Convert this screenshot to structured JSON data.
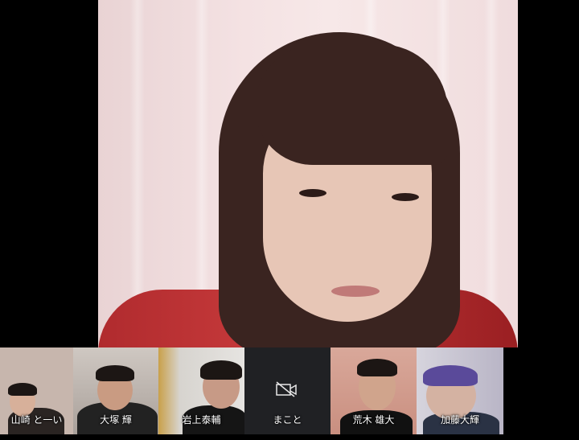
{
  "main_speaker": {
    "description_hidden": ""
  },
  "participants": [
    {
      "name": "山崎 と一い",
      "camera": "on"
    },
    {
      "name": "大塚 輝",
      "camera": "on"
    },
    {
      "name": "岩上泰輔",
      "camera": "on"
    },
    {
      "name": "まこと",
      "camera": "off"
    },
    {
      "name": "荒木 雄大",
      "camera": "on"
    },
    {
      "name": "加藤大輝",
      "camera": "on"
    }
  ],
  "icons": {
    "camera_off": "video-off-icon"
  }
}
